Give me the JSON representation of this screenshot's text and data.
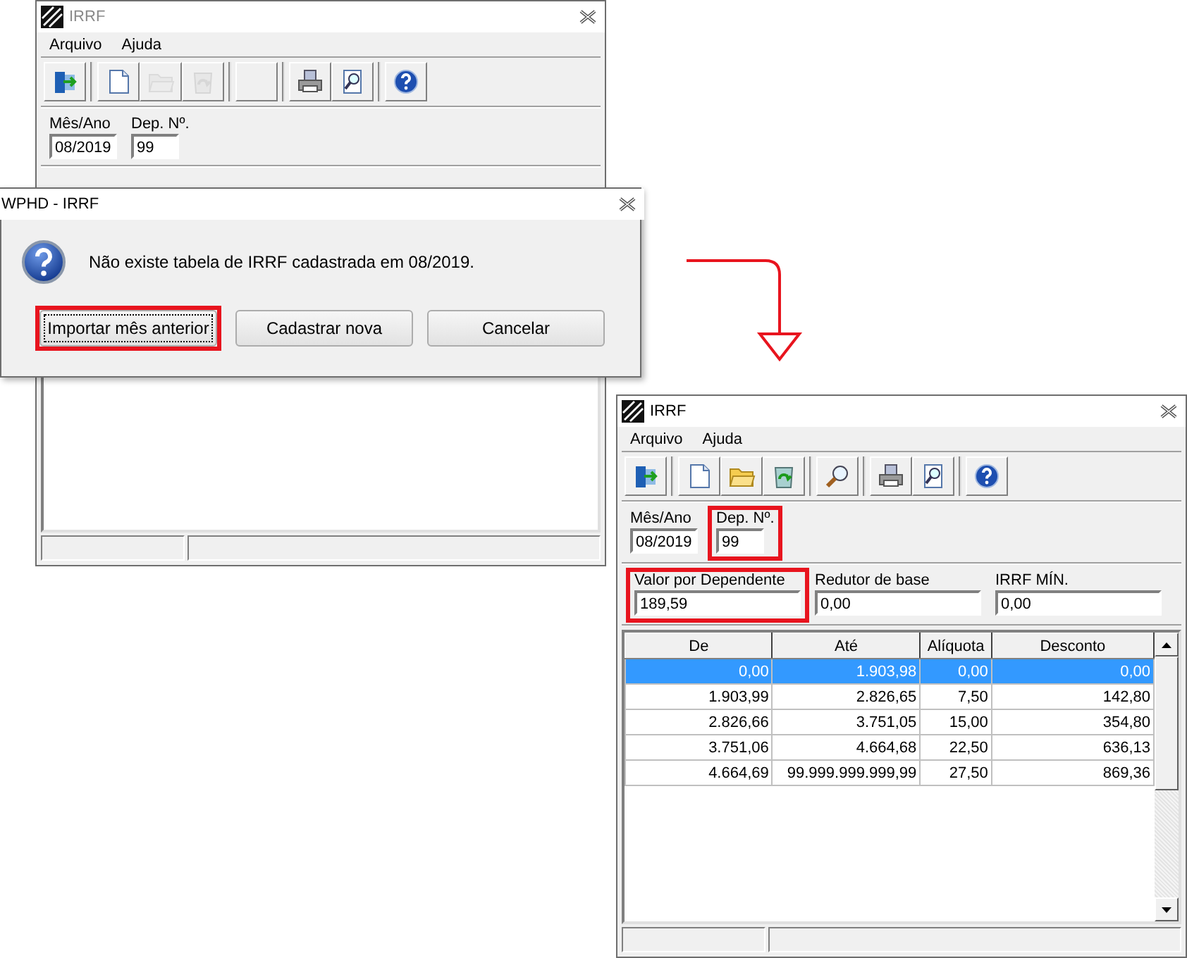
{
  "main_window": {
    "title": "IRRF",
    "active": false,
    "menu": [
      "Arquivo",
      "Ajuda"
    ],
    "toolbar": [
      [
        {
          "kind": "exit",
          "disabled": false
        }
      ],
      [
        {
          "kind": "new",
          "disabled": false
        },
        {
          "kind": "open",
          "disabled": true
        },
        {
          "kind": "save",
          "disabled": true
        }
      ],
      [
        {
          "kind": "search",
          "disabled": true
        }
      ],
      [
        {
          "kind": "print",
          "disabled": false
        },
        {
          "kind": "preview",
          "disabled": false
        }
      ],
      [
        {
          "kind": "help",
          "disabled": false
        }
      ]
    ],
    "fields": [
      {
        "label": "Mês/Ano",
        "value": "08/2019",
        "highlighted": false
      },
      {
        "label": "Dep. Nº.",
        "value": "99",
        "highlighted": false
      }
    ]
  },
  "dialog": {
    "title": "WPHD - IRRF",
    "message": "Não existe tabela de IRRF cadastrada em 08/2019.",
    "buttons": [
      {
        "label": "Importar mês anterior",
        "focused": true,
        "highlighted": true
      },
      {
        "label": "Cadastrar nova",
        "focused": false,
        "highlighted": false
      },
      {
        "label": "Cancelar",
        "focused": false,
        "highlighted": false
      }
    ]
  },
  "result_window": {
    "title": "IRRF",
    "active": true,
    "menu": [
      "Arquivo",
      "Ajuda"
    ],
    "toolbar": [
      [
        {
          "kind": "exit",
          "disabled": false
        }
      ],
      [
        {
          "kind": "new",
          "disabled": false
        },
        {
          "kind": "open",
          "disabled": false
        },
        {
          "kind": "save",
          "disabled": false
        }
      ],
      [
        {
          "kind": "search",
          "disabled": false
        }
      ],
      [
        {
          "kind": "print",
          "disabled": false
        },
        {
          "kind": "preview",
          "disabled": false
        }
      ],
      [
        {
          "kind": "help",
          "disabled": false
        }
      ]
    ],
    "fields": [
      {
        "label": "Mês/Ano",
        "value": "08/2019",
        "highlighted": false
      },
      {
        "label": "Dep. Nº.",
        "value": "99",
        "highlighted": true
      }
    ],
    "parameters": [
      {
        "label": "Valor por Dependente",
        "value": "189,59",
        "highlighted": true
      },
      {
        "label": "Redutor de base",
        "value": "0,00",
        "highlighted": false
      },
      {
        "label": "IRRF MÍN.",
        "value": "0,00",
        "highlighted": false
      }
    ],
    "table": {
      "columns": [
        "De",
        "Até",
        "Alíquota",
        "Desconto"
      ],
      "rows": [
        {
          "cells": [
            "0,00",
            "1.903,98",
            "0,00",
            "0,00"
          ],
          "selected": true
        },
        {
          "cells": [
            "1.903,99",
            "2.826,65",
            "7,50",
            "142,80"
          ],
          "selected": false
        },
        {
          "cells": [
            "2.826,66",
            "3.751,05",
            "15,00",
            "354,80"
          ],
          "selected": false
        },
        {
          "cells": [
            "3.751,06",
            "4.664,68",
            "22,50",
            "636,13"
          ],
          "selected": false
        },
        {
          "cells": [
            "4.664,69",
            "99.999.999.999,99",
            "27,50",
            "869,36"
          ],
          "selected": false
        }
      ]
    }
  }
}
